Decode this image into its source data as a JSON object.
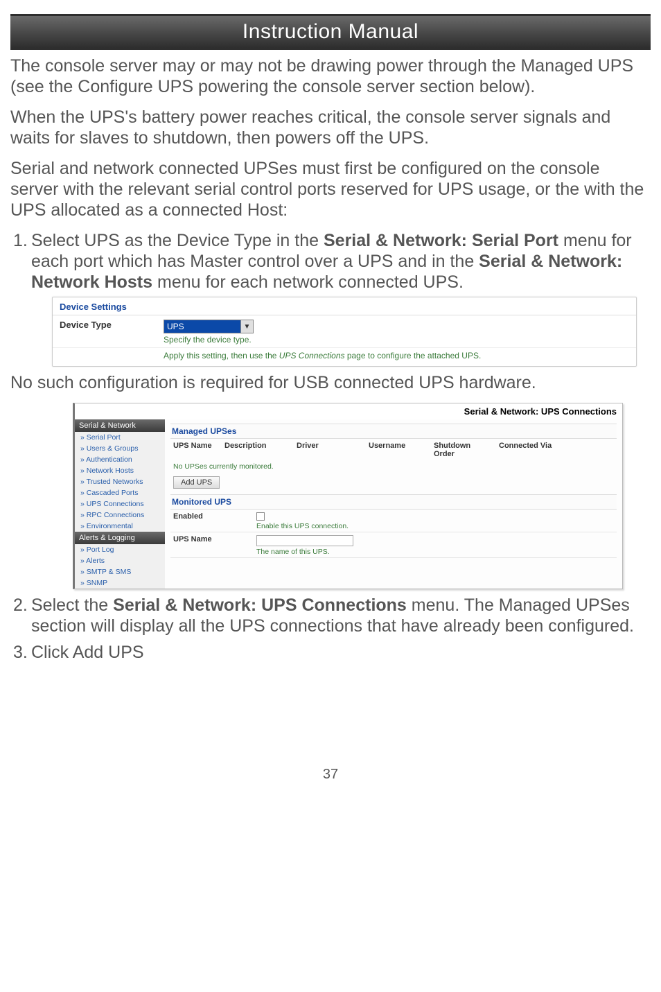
{
  "header": {
    "title": "Instruction Manual"
  },
  "para1": "The console server may or may not be drawing power through the Managed UPS (see the Configure UPS powering the console server section below).",
  "para2": "When the UPS's battery power reaches critical, the console server signals and waits for slaves to shutdown, then powers off the UPS.",
  "para3": "Serial and network connected UPSes must first be configured on the console server with the relevant serial control ports reserved for UPS usage, or the with the UPS allocated as a connected Host:",
  "step1": {
    "num": "1.",
    "pre": "Select  UPS as the Device Type in the ",
    "b1": "Serial & Network: Serial Port",
    "mid": " menu for each port which has Master control over a UPS and in the ",
    "b2": "Serial & Network: Network Hosts",
    "post": " menu for each network connected UPS."
  },
  "shot1": {
    "title": "Device Settings",
    "label": "Device Type",
    "select_value": "UPS",
    "help": "Specify the device type.",
    "note_pre": "Apply this setting, then use the ",
    "note_em": "UPS Connections",
    "note_post": " page to configure the attached UPS."
  },
  "para4": "No such configuration is required for USB connected UPS hardware.",
  "shot2": {
    "crumbs": "Serial & Network: UPS Connections",
    "sidebar": {
      "group1": {
        "head": "Serial & Network",
        "items": [
          "» Serial Port",
          "» Users & Groups",
          "» Authentication",
          "» Network Hosts",
          "» Trusted Networks",
          "» Cascaded Ports",
          "» UPS Connections",
          "» RPC Connections",
          "» Environmental"
        ]
      },
      "group2": {
        "head": "Alerts & Logging",
        "items": [
          "» Port Log",
          "» Alerts",
          "» SMTP & SMS",
          "» SNMP"
        ]
      }
    },
    "managed": {
      "title": "Managed UPSes",
      "cols": [
        "UPS Name",
        "Description",
        "Driver",
        "Username",
        "Shutdown Order",
        "Connected Via"
      ],
      "empty": "No UPSes currently monitored.",
      "add_btn": "Add UPS"
    },
    "monitored": {
      "title": "Monitored UPS",
      "enabled_label": "Enabled",
      "enabled_help": "Enable this UPS connection.",
      "name_label": "UPS Name",
      "name_value": "",
      "name_help": "The name of this UPS."
    }
  },
  "step2": {
    "num": "2.",
    "pre": "Select the ",
    "b1": "Serial & Network: UPS Connections",
    "post": " menu. The Managed UPSes section will display all the UPS connections that have already been configured."
  },
  "step3": {
    "num": "3.",
    "text": "Click Add UPS"
  },
  "page_number": "37"
}
